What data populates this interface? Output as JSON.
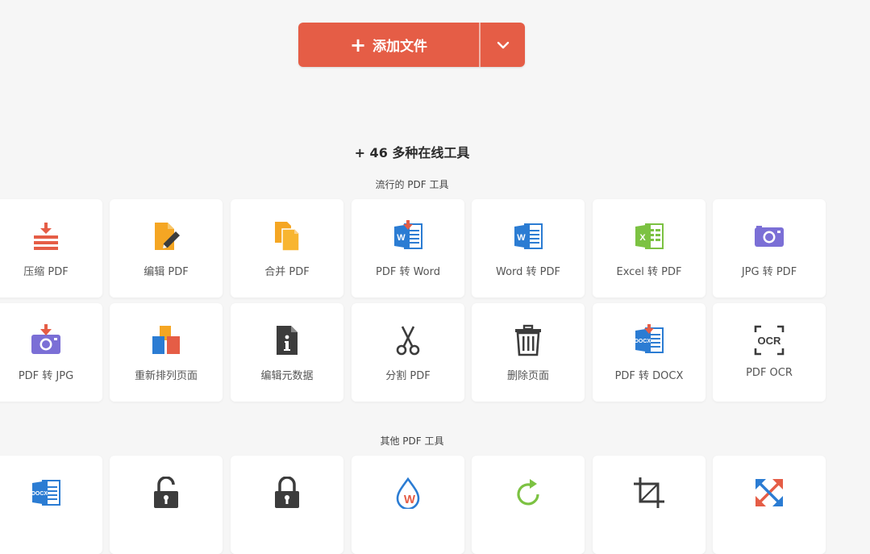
{
  "add_button": {
    "label": "添加文件",
    "plus": "+"
  },
  "tools_heading": "+ 46 多种在线工具",
  "popular_section": {
    "title": "流行的 PDF 工具",
    "tools": [
      {
        "label": "压缩 PDF",
        "icon": "compress-icon"
      },
      {
        "label": "编辑 PDF",
        "icon": "edit-pdf-icon"
      },
      {
        "label": "合并 PDF",
        "icon": "merge-icon"
      },
      {
        "label": "PDF 转 Word",
        "icon": "pdf-to-word-icon"
      },
      {
        "label": "Word 转 PDF",
        "icon": "word-to-pdf-icon"
      },
      {
        "label": "Excel 转 PDF",
        "icon": "excel-to-pdf-icon"
      },
      {
        "label": "JPG 转 PDF",
        "icon": "jpg-to-pdf-icon"
      },
      {
        "label": "PDF 转 JPG",
        "icon": "pdf-to-jpg-icon"
      },
      {
        "label": "重新排列页面",
        "icon": "reorder-pages-icon"
      },
      {
        "label": "编辑元数据",
        "icon": "metadata-icon"
      },
      {
        "label": "分割 PDF",
        "icon": "scissors-icon"
      },
      {
        "label": "删除页面",
        "icon": "trash-icon"
      },
      {
        "label": "PDF 转 DOCX",
        "icon": "pdf-to-docx-icon"
      },
      {
        "label": "PDF OCR",
        "icon": "ocr-icon"
      }
    ]
  },
  "other_section": {
    "title": "其他 PDF 工具",
    "tools": [
      {
        "icon": "docx-icon"
      },
      {
        "icon": "unlock-icon"
      },
      {
        "icon": "lock-icon"
      },
      {
        "icon": "watermark-icon"
      },
      {
        "icon": "rotate-icon"
      },
      {
        "icon": "crop-icon"
      },
      {
        "icon": "resize-icon"
      }
    ]
  },
  "icon_text": {
    "word": "W",
    "excel": "X",
    "docx": "DOCX",
    "ocr": "OCR",
    "info": "i"
  },
  "colors": {
    "accent": "#e55d46",
    "word_blue": "#2b7cd3",
    "excel_green": "#7cc242",
    "purple": "#7b6fd6",
    "orange": "#f5a623",
    "dark": "#3c3c3c"
  }
}
